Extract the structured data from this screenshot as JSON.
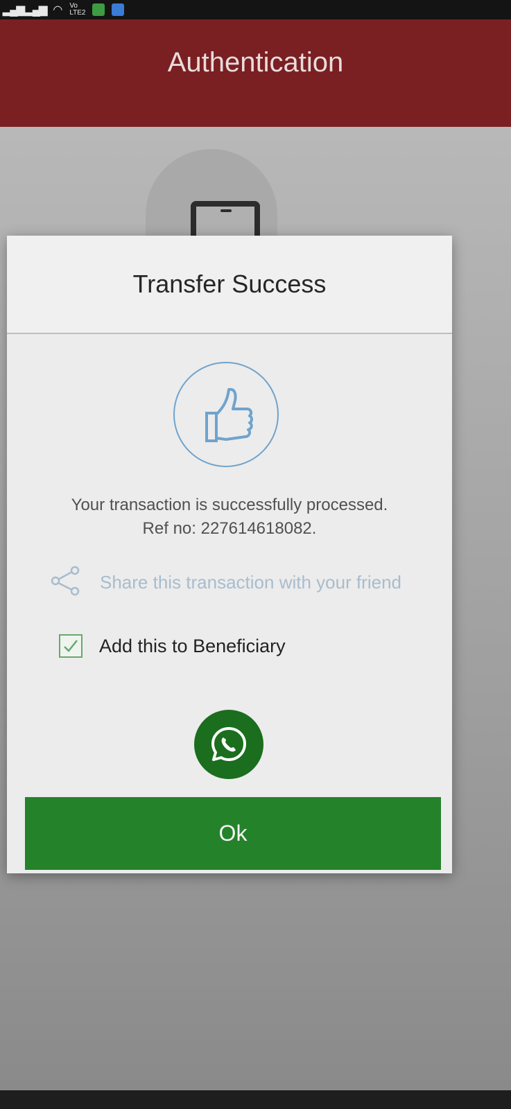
{
  "status_bar": {
    "volte_top": "Vo",
    "volte_bottom": "LTE2"
  },
  "app_bar": {
    "title": "Authentication"
  },
  "dialog": {
    "title": "Transfer Success",
    "message_line1": "Your transaction is successfully processed.",
    "message_line2": "Ref no: 227614618082.",
    "share_label": "Share this transaction with your friend",
    "beneficiary_label": "Add this to Beneficiary",
    "beneficiary_checked": true,
    "ok_label": "Ok"
  },
  "icons": {
    "success": "thumbs-up-icon",
    "share": "share-icon",
    "whatsapp": "whatsapp-icon",
    "checkbox": "checkmark-icon"
  },
  "colors": {
    "app_bar": "#7a1f22",
    "ok_button": "#24822b",
    "whatsapp_button": "#1a6e1e",
    "thumb_icon": "#6fa3cc",
    "share_text": "#a8bccd"
  }
}
